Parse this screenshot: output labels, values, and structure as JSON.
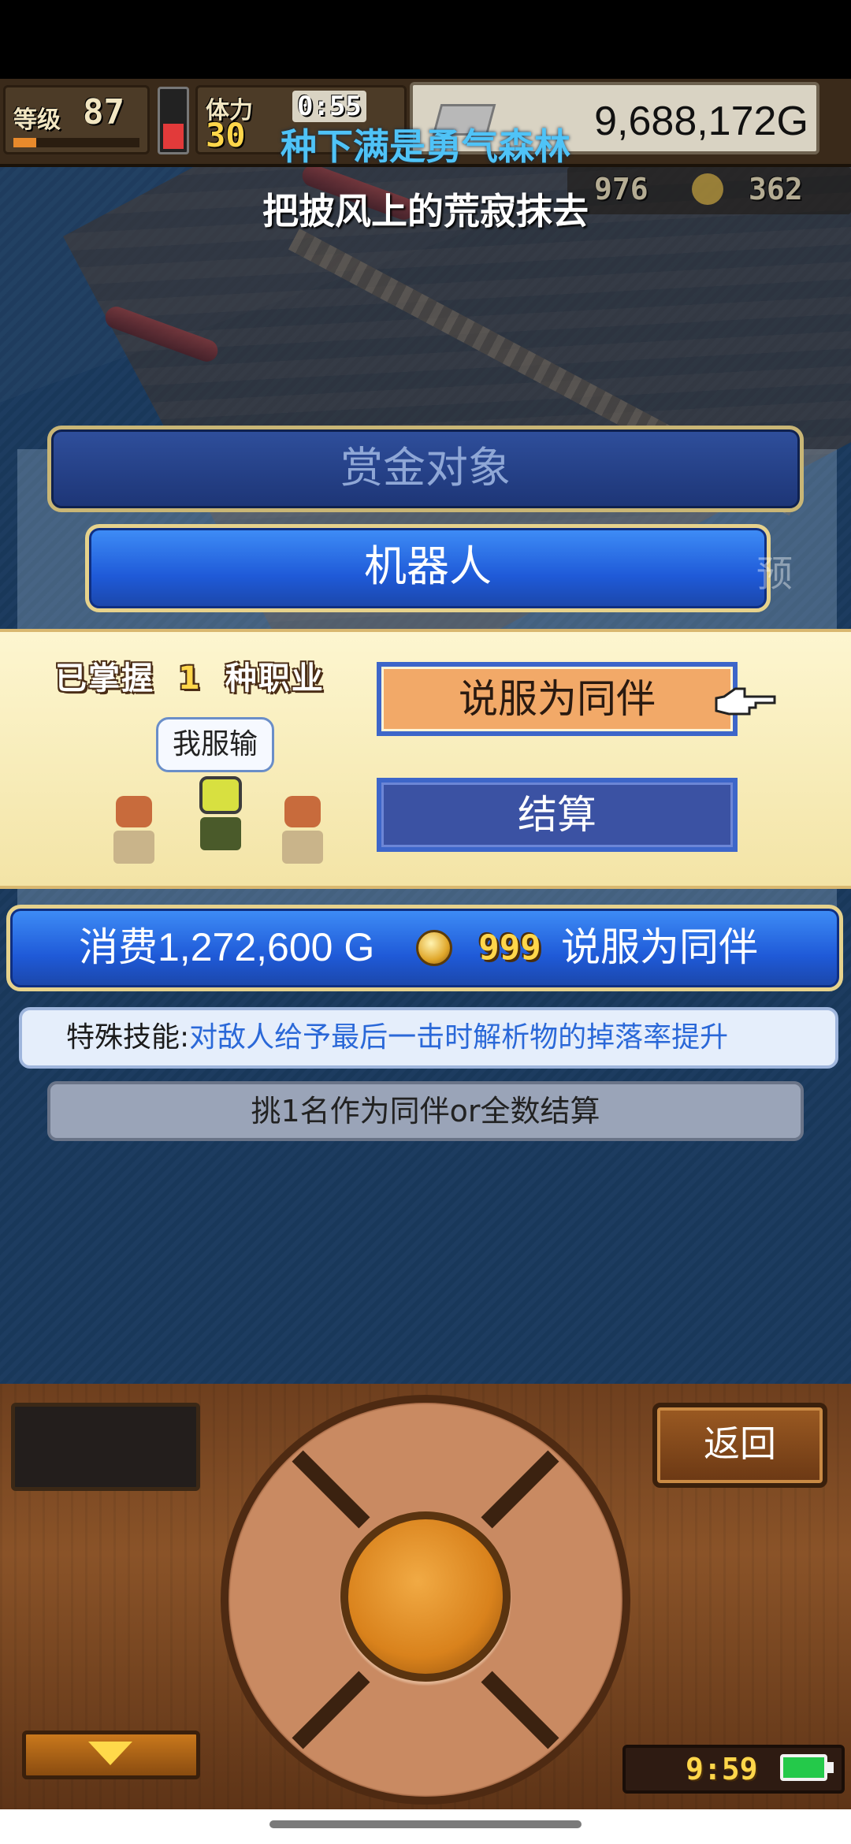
{
  "hud": {
    "level_label": "等级",
    "level": "87",
    "stamina_label": "体力",
    "stamina": "30",
    "timer": "0:55",
    "gold": "9,688,172G",
    "stat_a": "976",
    "stat_b": "362"
  },
  "lyrics": {
    "line1": "种下满是勇气森林",
    "line2": "把披风上的荒寂抹去"
  },
  "bounty": {
    "title": "赏金对象",
    "target_name": "机器人",
    "side_char": "预"
  },
  "modal": {
    "learned_prefix": "已掌握",
    "learned_count": "1",
    "learned_suffix": "种职业",
    "speech_bubble": "我服输",
    "recruit_label": "说服为同伴",
    "settle_label": "结算"
  },
  "cost": {
    "text": "消费1,272,600 G",
    "medal_count": "999",
    "action": "说服为同伴"
  },
  "skill": {
    "label": "特殊技能:",
    "description": "对敌人给予最后一击时解析物的掉落率提升"
  },
  "hint": "挑1名作为同伴or全数结算",
  "controller": {
    "back_label": "返回",
    "clock": "9:59"
  },
  "colors": {
    "lyric_accent": "#4fc3f7",
    "recruit_button": "#f2a968",
    "settle_button": "#3b52a3",
    "skill_text": "#2a68d8"
  }
}
